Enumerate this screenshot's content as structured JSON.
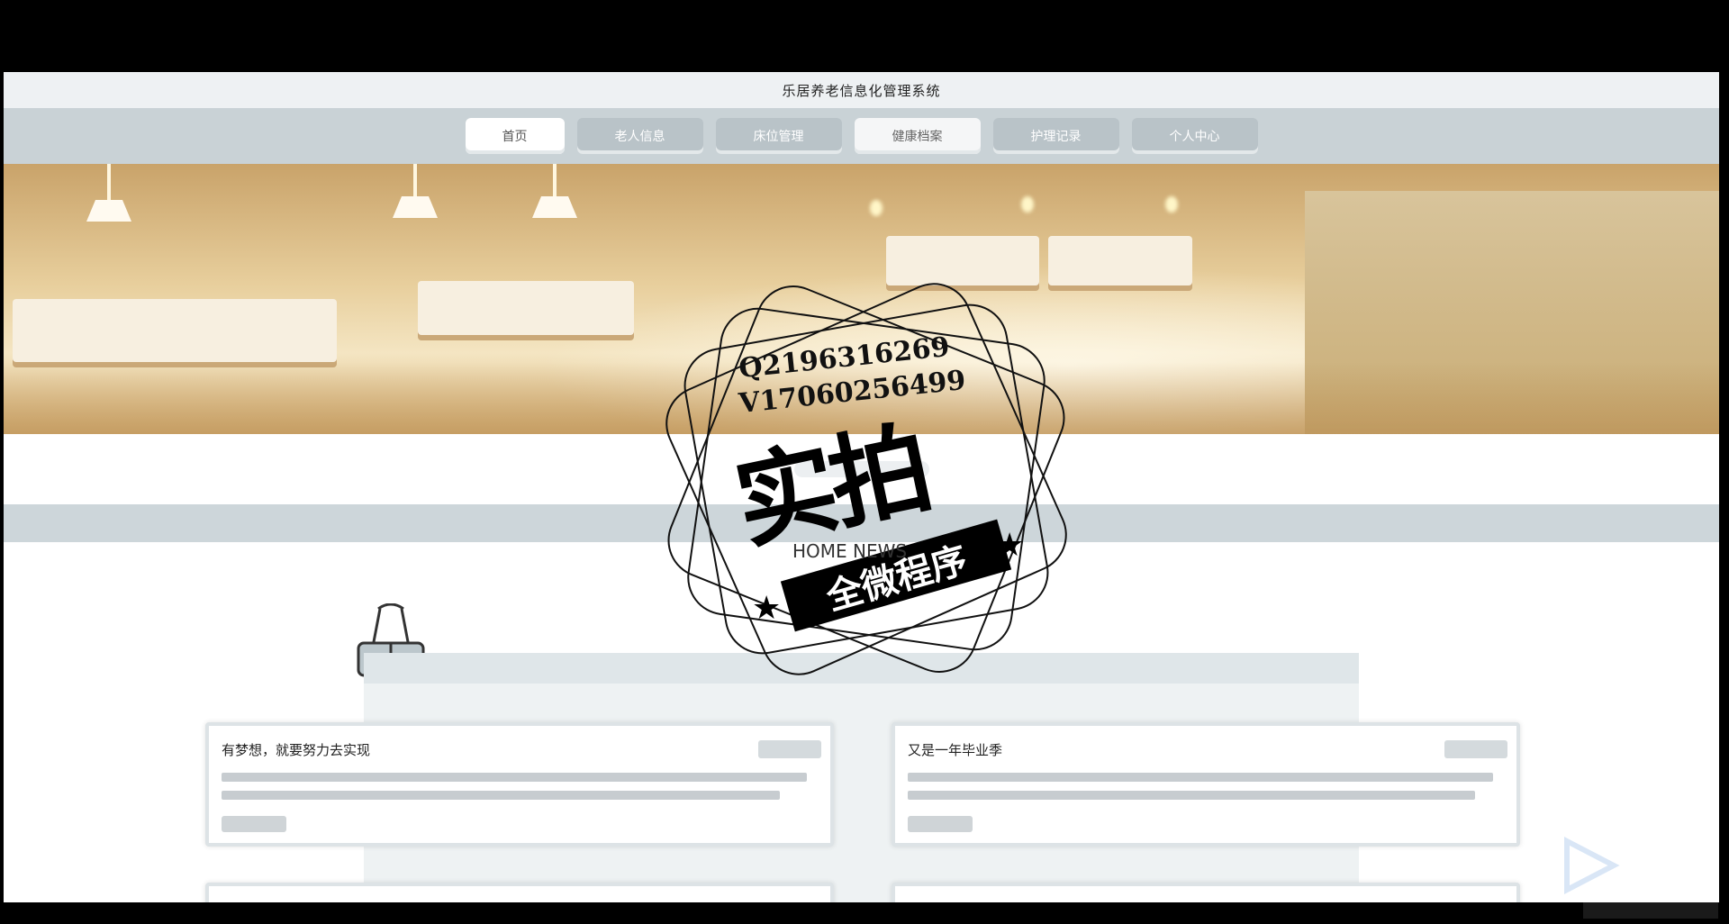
{
  "window": {
    "title": "乐居养老信息化管理系统"
  },
  "nav": {
    "items": [
      {
        "label": "首页"
      },
      {
        "label": "老人信息"
      },
      {
        "label": "床位管理"
      },
      {
        "label": "健康档案"
      },
      {
        "label": "护理记录"
      },
      {
        "label": "个人中心"
      }
    ]
  },
  "section": {
    "title_en": "HOME NEWS"
  },
  "news": [
    {
      "title": "有梦想，就要努力去实现"
    },
    {
      "title": "又是一年毕业季"
    }
  ],
  "watermark": {
    "qq": "Q2196316269",
    "wx": "V17060256499",
    "big": "实拍",
    "ribbon": "全微程序"
  },
  "colors": {
    "nav_bg": "#c9d2d6",
    "band": "#cdd6da",
    "card_border": "#dde3e6"
  }
}
